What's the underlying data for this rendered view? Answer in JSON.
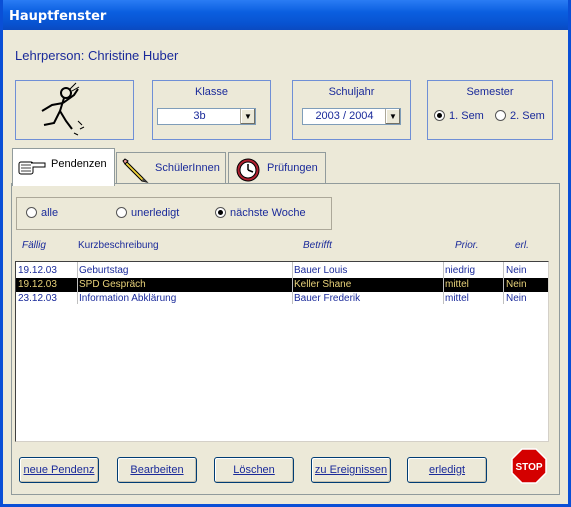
{
  "window": {
    "title": "Hauptfenster"
  },
  "header": {
    "teacher": "Lehrperson: Christine Huber"
  },
  "klasse": {
    "label": "Klasse",
    "value": "3b"
  },
  "schuljahr": {
    "label": "Schuljahr",
    "value": "2003 / 2004"
  },
  "semester": {
    "label": "Semester",
    "options": [
      "1. Sem",
      "2. Sem"
    ],
    "selected": "1. Sem"
  },
  "tabs": [
    {
      "label": "Pendenzen",
      "icon": "pointing-hand-icon",
      "active": true
    },
    {
      "label": "SchülerInnen",
      "icon": "pencil-icon",
      "active": false
    },
    {
      "label": "Prüfungen",
      "icon": "clock-icon",
      "active": false
    }
  ],
  "filter": {
    "options": [
      "alle",
      "unerledigt",
      "nächste Woche"
    ],
    "selected": "nächste Woche"
  },
  "columns": [
    "Fällig",
    "Kurzbeschreibung",
    "Betrifft",
    "Prior.",
    "erl."
  ],
  "rows": [
    {
      "date": "19.12.03",
      "desc": "Geburtstag",
      "about": "Bauer Louis",
      "prio": "niedrig",
      "done": "Nein",
      "selected": false
    },
    {
      "date": "19.12.03",
      "desc": "SPD Gespräch",
      "about": "Keller Shane",
      "prio": "mittel",
      "done": "Nein",
      "selected": true
    },
    {
      "date": "23.12.03",
      "desc": "Information Abklärung",
      "about": "Bauer Frederik",
      "prio": "mittel",
      "done": "Nein",
      "selected": false
    }
  ],
  "buttons": {
    "new": "neue Pendenz",
    "edit": "Bearbeiten",
    "delete": "Löschen",
    "events": "zu Ereignissen",
    "done": "erledigt",
    "stop": "STOP"
  },
  "colors": {
    "titlebar": "#0a4fd6",
    "text": "#1a2a9a",
    "selection": "#000000",
    "selection_text": "#e8d27a",
    "stop": "#d40000"
  }
}
